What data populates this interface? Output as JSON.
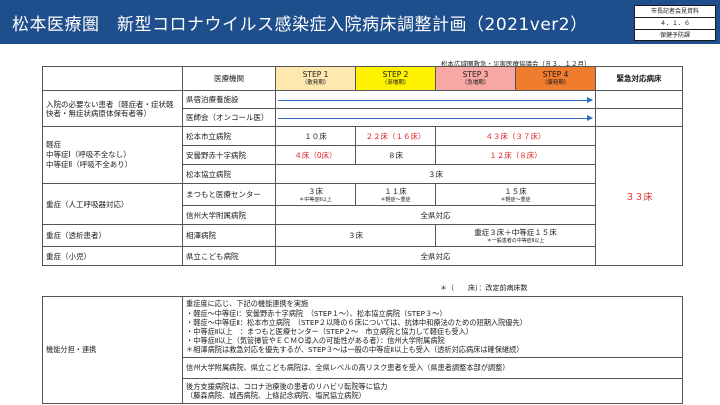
{
  "header": {
    "title": "松本医療圏　新型コロナウイルス感染症入院病床調整計画（2021ver2）",
    "stamp": [
      "市長記者会見資料",
      "４．１．６",
      "保健予防課"
    ]
  },
  "source_note": "松本広域圏救急・災害医療協議会（Ｒ３．１２月）",
  "table": {
    "col_header": "医療機関",
    "steps": [
      {
        "label": "STEP 1",
        "sub": "（散発期）",
        "color": "#fde8b0"
      },
      {
        "label": "STEP 2",
        "sub": "（漸増期）",
        "color": "#fff200"
      },
      {
        "label": "STEP 3",
        "sub": "（急増期）",
        "color": "#f7a8a4"
      },
      {
        "label": "STEP 4",
        "sub": "（爆発期）",
        "color": "#f07c2e"
      }
    ],
    "emergency_header": "緊急対応病床",
    "emergency_beds": "３３床",
    "rows": {
      "no_hosp_cat": "入院の必要ない患者（軽症者・症状軽快者・無症状病原体保有者等）",
      "shukuhaku": "県宿泊療養施設",
      "ishikai": "医師会（オンコール医）",
      "mild_cat": "軽症\n中等症Ⅰ（呼吸不全なし）\n中等症Ⅱ（呼吸不全あり）",
      "matsumoto_city": {
        "name": "松本市立病院",
        "s1": "１０床",
        "s2": "２２床（１６床）",
        "s34": "４３床（３７床）"
      },
      "azumino": {
        "name": "安曇野赤十字病院",
        "s1": "４床（0床）",
        "s2": "８床",
        "s34": "１２床（８床）"
      },
      "kyoritsu": {
        "name": "松本協立病院",
        "s1234": "３床"
      },
      "severe_cat": "重症（人工呼吸器対応）",
      "matsumoto_center": {
        "name": "まつもと医療センター",
        "s1": "３床",
        "s1_sub": "＊中等症Ⅱ以上",
        "s2": "１１床",
        "s2_sub": "＊軽症～重症",
        "s34": "１５床",
        "s34_sub": "＊軽症～重症"
      },
      "shinshu_univ": {
        "name": "信州大学附属病院",
        "value": "全県対応"
      },
      "dialysis_cat": "重症（透析患者）",
      "aizawa": {
        "name": "相澤病院",
        "s12": "３床",
        "s34": "重症３床＋中等症１５床",
        "s34_sub": "＊一般患者の中等症Ⅱ以上"
      },
      "child_cat": "重症（小児）",
      "kodomo": {
        "name": "県立こども病院",
        "value": "全県対応"
      }
    }
  },
  "footnote": "＊（　　床）：改定前病床数",
  "function_table": {
    "label": "機能分担・連携",
    "block1": [
      "重症度に応じ、下記の機能連携を実施",
      "・軽症～中等症Ⅰ：安曇野赤十字病院　（STEP１～）、松本協立病院（STEP３～）",
      "・軽症～中等症Ⅱ：松本市立病院　（STEP２以降の６床については、抗体中和療法のための短期入院優先）",
      "・中等症Ⅱ以上　：まつもと医療センター（STEP２～　市立病院と協力して軽症も受入）",
      "・中等症Ⅱ以上（気管挿管やＥＣＭＯ導入の可能性がある者）：信州大学附属病院",
      "＊相澤病院は救急対応を優先するが、STEP３～は一般の中等症Ⅱ以上も受入（透析対応病床は確保継続）"
    ],
    "block2": "信州大学附属病院、県立こども病院は、全県レベルの高リスク患者を受入（県患者調整本部が調整）",
    "block3": [
      "後方支援病院は、コロナ治療後の患者のリハビリ転院等に協力",
      "（藤森病院、城西病院、上條記念病院、塩尻協立病院）"
    ]
  }
}
